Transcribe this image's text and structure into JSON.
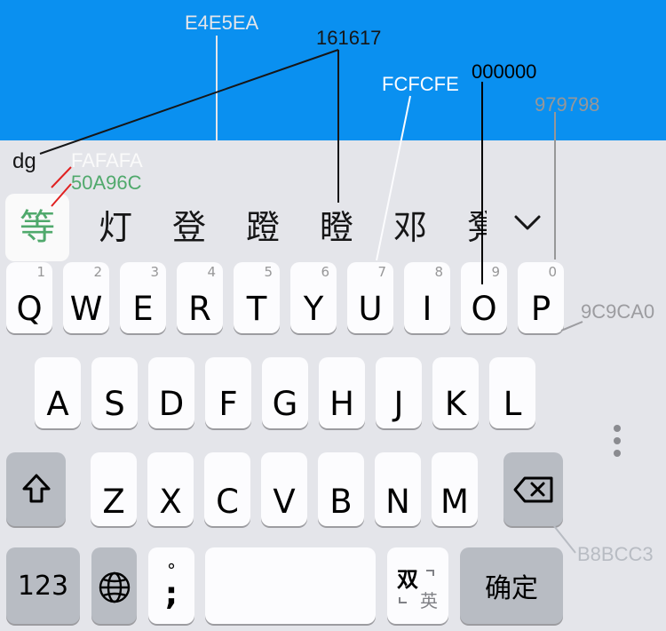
{
  "colors": {
    "top_bar": "#0A90F0",
    "keyboard_bg": "#E4E5EA",
    "key_bg": "#FCFCFE",
    "key_shadow": "#9C9CA0",
    "function_key_bg": "#B8BCC3",
    "candidate_highlight_bg": "#FAFAFA",
    "candidate_highlight_text": "#50A96C",
    "candidate_text": "#161617",
    "key_text": "#000000",
    "number_hint": "#979798"
  },
  "annotations": {
    "keyboard_bg": "E4E5EA",
    "candidate_text": "161617",
    "key_bg": "FCFCFE",
    "key_text": "000000",
    "number_hint": "979798",
    "highlight_bg": "FAFAFA",
    "highlight_text": "50A96C",
    "key_shadow": "9C9CA0",
    "function_key": "B8BCC3",
    "input_text": "dg"
  },
  "candidates": {
    "selected": "等",
    "items": [
      "灯",
      "登",
      "蹬",
      "瞪",
      "邓",
      "凳"
    ]
  },
  "rows": {
    "row1": [
      {
        "label": "Q",
        "num": "1"
      },
      {
        "label": "W",
        "num": "2"
      },
      {
        "label": "E",
        "num": "3"
      },
      {
        "label": "R",
        "num": "4"
      },
      {
        "label": "T",
        "num": "5"
      },
      {
        "label": "Y",
        "num": "6"
      },
      {
        "label": "U",
        "num": "7"
      },
      {
        "label": "I",
        "num": "8"
      },
      {
        "label": "O",
        "num": "9"
      },
      {
        "label": "P",
        "num": "0"
      }
    ],
    "row2": [
      "A",
      "S",
      "D",
      "F",
      "G",
      "H",
      "J",
      "K",
      "L"
    ],
    "row3": [
      "Z",
      "X",
      "C",
      "V",
      "B",
      "N",
      "M"
    ]
  },
  "bottom": {
    "numbers_label": "123",
    "punct_top": "°",
    "punct_bottom": ";",
    "space_label": "",
    "lang_top": "双",
    "lang_bottom": "英",
    "confirm_label": "确定"
  },
  "icons": {
    "shift": "shift-icon",
    "delete": "backspace-icon",
    "globe": "globe-icon",
    "collapse": "chevron-down-icon",
    "more": "vertical-dots-icon"
  }
}
